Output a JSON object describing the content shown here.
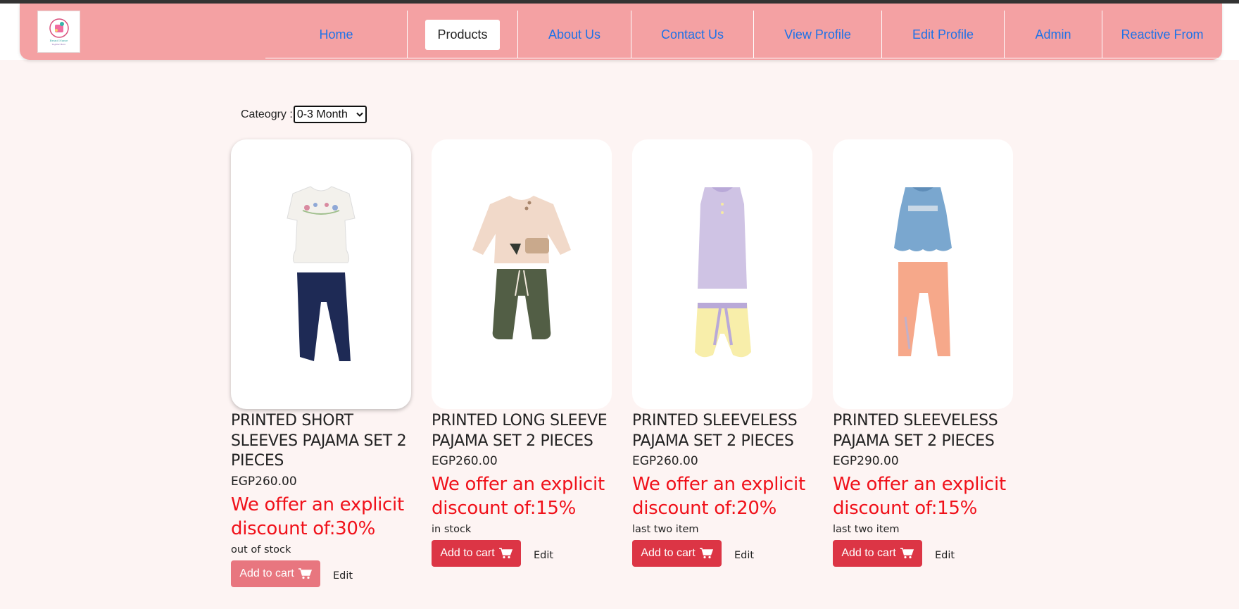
{
  "nav": {
    "logo_text": "Brand Name",
    "logo_sub": "Tagline Here",
    "items": [
      {
        "label": "Home",
        "active": false
      },
      {
        "label": "Products",
        "active": true
      },
      {
        "label": "About Us",
        "active": false
      },
      {
        "label": "Contact Us",
        "active": false
      },
      {
        "label": "View Profile",
        "active": false
      },
      {
        "label": "Edit Profile",
        "active": false
      },
      {
        "label": "Admin",
        "active": false
      },
      {
        "label": "Reactive From",
        "active": false
      }
    ]
  },
  "filter": {
    "label": "Cateogry :",
    "selected": "0-3 Month"
  },
  "products": [
    {
      "title": "PRINTED SHORT SLEEVES PAJAMA SET 2 PIECES",
      "price": "EGP260.00",
      "offer": "We offer an explicit discount of:30%",
      "stock": "out of stock",
      "cart_label": "Add to cart",
      "edit_label": "Edit"
    },
    {
      "title": "PRINTED LONG SLEEVE PAJAMA SET 2 PIECES",
      "price": "EGP260.00",
      "offer": "We offer an explicit discount of:15%",
      "stock": "in stock",
      "cart_label": "Add to cart",
      "edit_label": "Edit"
    },
    {
      "title": "PRINTED SLEEVELESS PAJAMA SET 2 PIECES",
      "price": "EGP260.00",
      "offer": "We offer an explicit discount of:20%",
      "stock": "last two item",
      "cart_label": "Add to cart",
      "edit_label": "Edit"
    },
    {
      "title": "PRINTED SLEEVELESS PAJAMA SET 2 PIECES",
      "price": "EGP290.00",
      "offer": "We offer an explicit discount of:15%",
      "stock": "last two item",
      "cart_label": "Add to cart",
      "edit_label": "Edit"
    }
  ],
  "colors": {
    "navbar": "#f4a1a3",
    "page_bg": "#fdf4f3",
    "nav_link": "#1d72e8",
    "offer": "#f0111a",
    "cart_button": "#dc3545"
  }
}
